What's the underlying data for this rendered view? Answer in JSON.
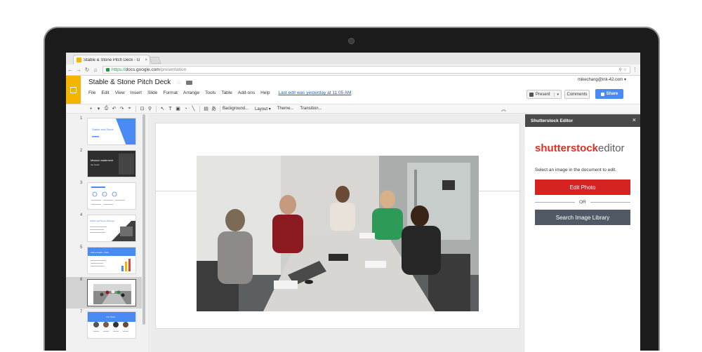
{
  "browser": {
    "tab_title": "Stable & Stone Pitch Deck - G",
    "url_scheme": "https://",
    "url_host": "docs.google.com",
    "url_path": "/presentation"
  },
  "app": {
    "doc_title": "Stable & Stone Pitch Deck",
    "account": "mikechang@ink-42.com",
    "menu": [
      "File",
      "Edit",
      "View",
      "Insert",
      "Slide",
      "Format",
      "Arrange",
      "Tools",
      "Table",
      "Add-ons",
      "Help"
    ],
    "last_edit": "Last edit was yesterday at 11:05 AM",
    "present_label": "Present",
    "comments_label": "Comments",
    "share_label": "Share",
    "accent_color": "#f4b400"
  },
  "toolbar": {
    "background_label": "Background...",
    "layout_label": "Layout",
    "theme_label": "Theme...",
    "transition_label": "Transition..."
  },
  "filmstrip": {
    "slides": [
      {
        "num": "1",
        "title": "Stable and Stone"
      },
      {
        "num": "2",
        "title": "Mission statement",
        "subtitle": "the bould"
      },
      {
        "num": "3"
      },
      {
        "num": "4",
        "title": "Stable and Stone Strategy"
      },
      {
        "num": "5",
        "title": "Add a Graph, Chart"
      },
      {
        "num": "6"
      },
      {
        "num": "7",
        "title": "The Team"
      }
    ],
    "selected": 6
  },
  "sidebar": {
    "title": "Shutterstock Editor",
    "logo_brand": "shutterstock",
    "logo_editor": "editor",
    "instruction": "Select an image in the document to edit.",
    "edit_photo_label": "Edit Photo",
    "or_label": "OR",
    "search_label": "Search Image Library",
    "edit_color": "#d72222",
    "search_color": "#505a64"
  }
}
